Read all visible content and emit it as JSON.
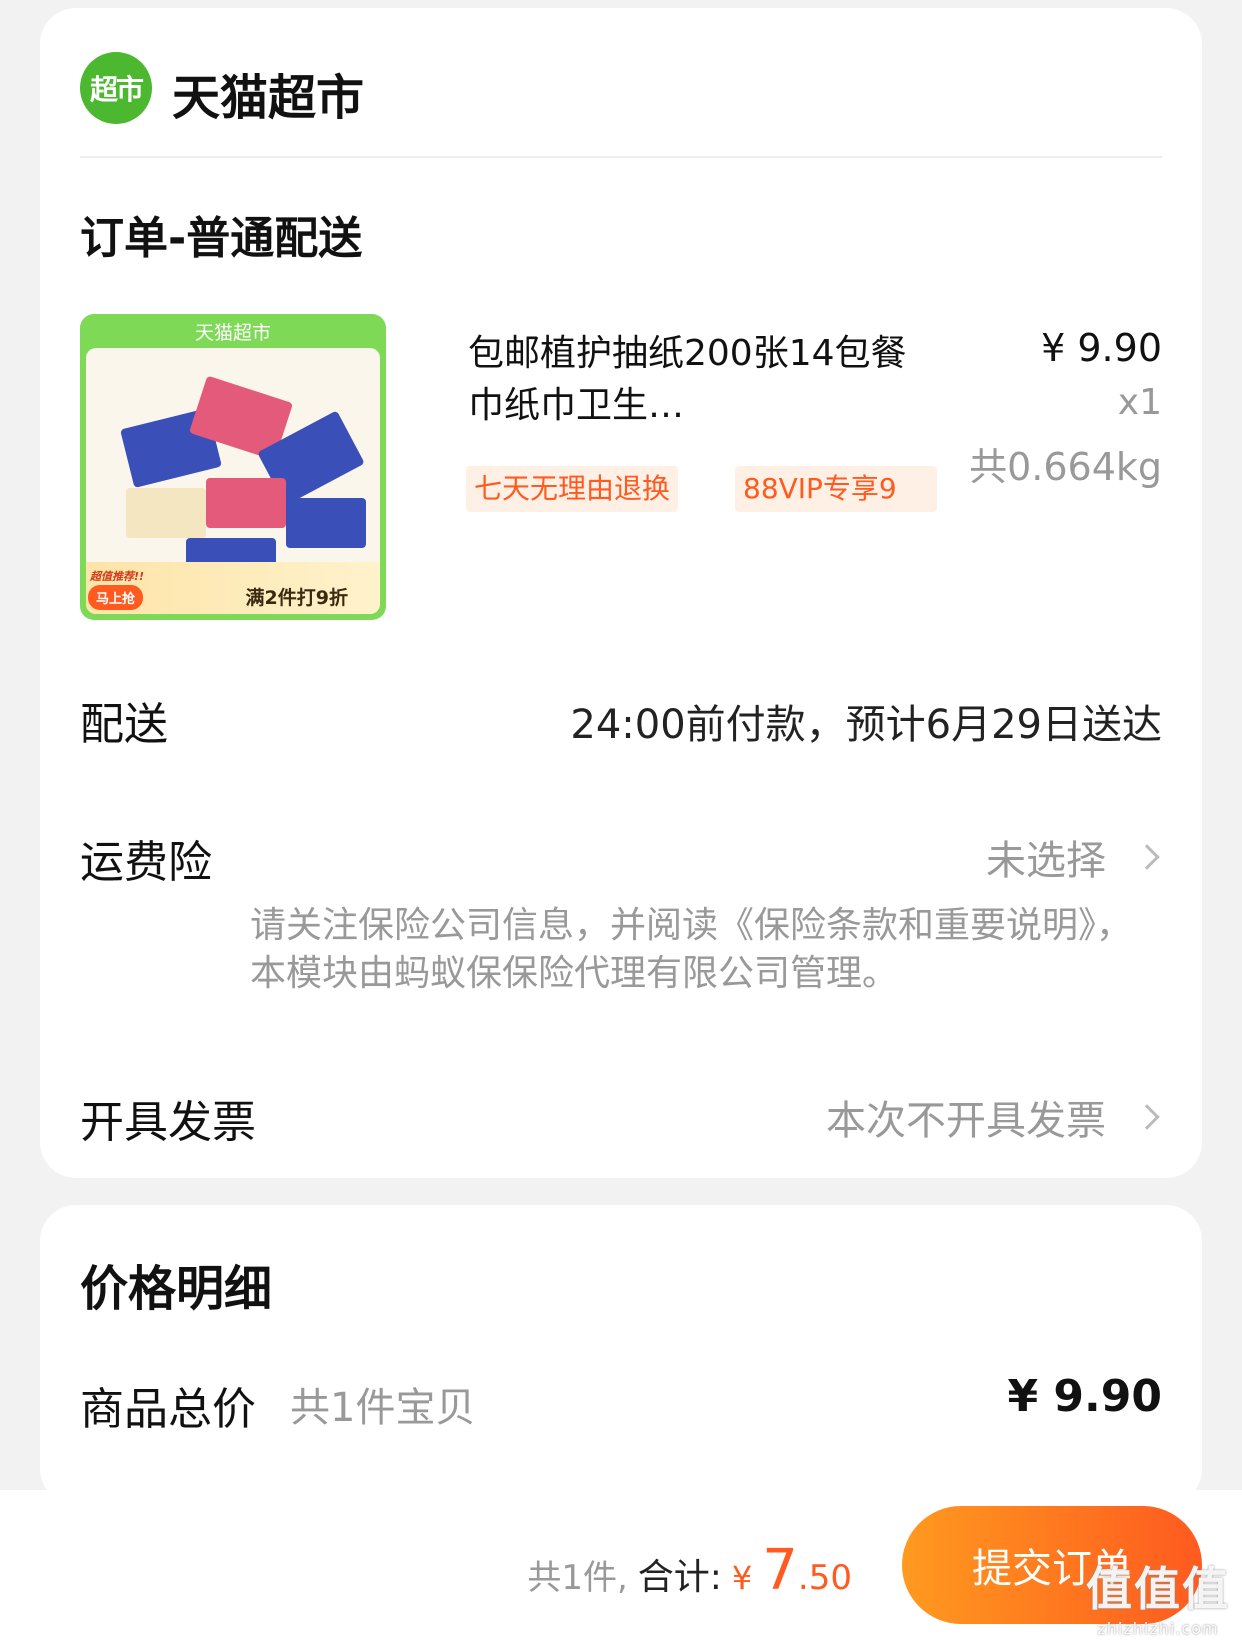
{
  "store": {
    "logo_text": "超市",
    "name": "天猫超市"
  },
  "order": {
    "title": "订单-普通配送",
    "product": {
      "thumb_tag": "天猫超市",
      "thumb_recommend": "超值推荐!!",
      "thumb_buy": "马上抢",
      "thumb_promo": "满2件打9折",
      "title": "包邮植护抽纸200张14包餐巾纸巾卫生…",
      "tags": [
        "七天无理由退换",
        "88VIP专享9"
      ],
      "unit_price": "¥ 9.90",
      "quantity": "x1",
      "weight": "共0.664kg"
    },
    "delivery": {
      "label": "配送",
      "value": "24:00前付款，预计6月29日送达"
    },
    "insurance": {
      "label": "运费险",
      "value": "未选择",
      "note": "请关注保险公司信息，并阅读《保险条款和重要说明》，本模块由蚂蚁保保险代理有限公司管理。"
    },
    "invoice": {
      "label": "开具发票",
      "value": "本次不开具发票"
    }
  },
  "price_detail": {
    "title": "价格明细",
    "total_label": "商品总价",
    "total_sub": "共1件宝贝",
    "total_value": "¥ 9.90"
  },
  "bottom_bar": {
    "count": "共1件,",
    "label": "合计:",
    "currency": "¥",
    "amount_int": "7",
    "amount_dec": ".50",
    "submit_label": "提交订单"
  },
  "watermark": {
    "glyph": "值值值",
    "url": "zhizhizhi.com"
  },
  "colors": {
    "accent": "#ff5a1f",
    "brand_green": "#4cb830",
    "tag_bg": "#fff0e6"
  }
}
